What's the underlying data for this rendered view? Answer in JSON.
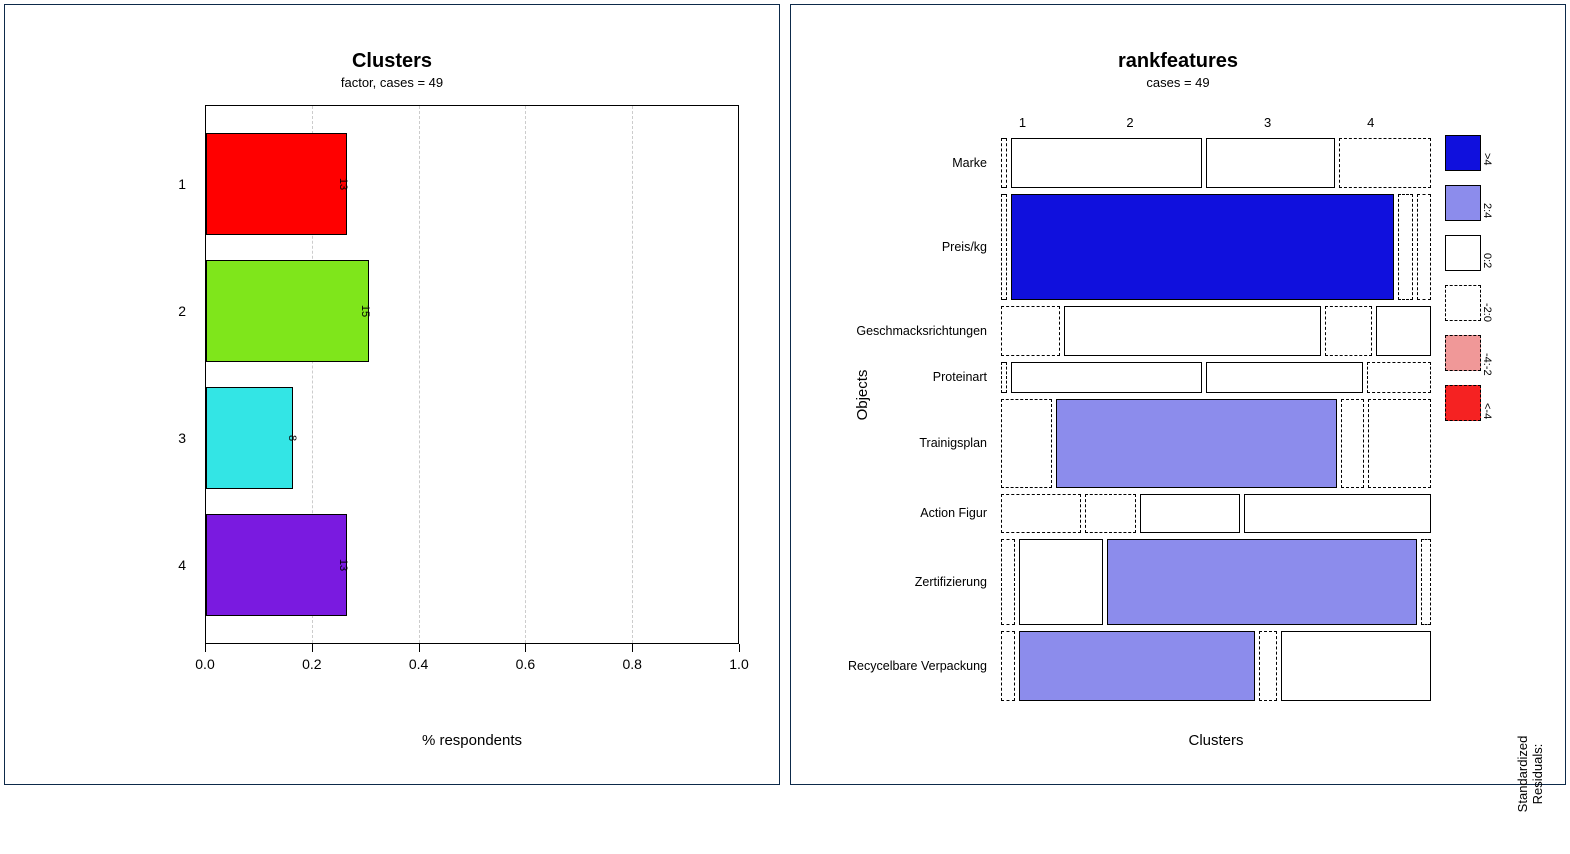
{
  "chart_data": [
    {
      "type": "bar",
      "title": "Clusters",
      "subtitle": "factor, cases = 49",
      "xlabel": "% respondents",
      "ylabel": "",
      "xlim": [
        0,
        1
      ],
      "x_ticks": [
        "0.0",
        "0.2",
        "0.4",
        "0.6",
        "0.8",
        "1.0"
      ],
      "grid_x": [
        0.2,
        0.4,
        0.6,
        0.8
      ],
      "categories": [
        "1",
        "2",
        "3",
        "4"
      ],
      "values": [
        0.265,
        0.306,
        0.163,
        0.265
      ],
      "counts": [
        13,
        15,
        8,
        13
      ],
      "colors": [
        "#ff0000",
        "#7fe61b",
        "#33e5e5",
        "#7a1ae0"
      ]
    },
    {
      "type": "mosaic",
      "title": "rankfeatures",
      "subtitle": "cases = 49",
      "xlabel": "Clusters",
      "ylabel": "Objects",
      "column_categories": [
        "1",
        "2",
        "3",
        "4"
      ],
      "row_categories": [
        "Marke",
        "Preis/kg",
        "Geschmacksrichtungen",
        "Proteinart",
        "Trainigsplan",
        "Action Figur",
        "Zertifizierung",
        "Recycelbare Verpackung"
      ],
      "row_heights": [
        0.095,
        0.205,
        0.095,
        0.06,
        0.17,
        0.075,
        0.165,
        0.135
      ],
      "cell_widths": [
        [
          0.01,
          0.46,
          0.31,
          0.22
        ],
        [
          0.01,
          0.93,
          0.03,
          0.03
        ],
        [
          0.14,
          0.62,
          0.11,
          0.13
        ],
        [
          0.01,
          0.46,
          0.38,
          0.15
        ],
        [
          0.12,
          0.68,
          0.05,
          0.15
        ],
        [
          0.19,
          0.12,
          0.24,
          0.45
        ],
        [
          0.03,
          0.2,
          0.75,
          0.02
        ],
        [
          0.03,
          0.57,
          0.04,
          0.36
        ]
      ],
      "residual_class": [
        [
          "neg",
          "zero",
          "zero",
          "neg"
        ],
        [
          "neg",
          "deep-blue",
          "neg",
          "neg"
        ],
        [
          "neg",
          "zero",
          "neg",
          "zero"
        ],
        [
          "neg",
          "zero",
          "zero",
          "neg"
        ],
        [
          "neg",
          "light-blue",
          "neg",
          "neg"
        ],
        [
          "neg",
          "neg",
          "zero",
          "zero"
        ],
        [
          "neg",
          "zero",
          "light-blue",
          "neg"
        ],
        [
          "neg",
          "light-blue",
          "neg",
          "zero"
        ]
      ],
      "legend": {
        "title": "Standardized\nResiduals:",
        "items": [
          {
            "class": "deep-blue",
            "label": ">4"
          },
          {
            "class": "light-blue",
            "label": "2:4"
          },
          {
            "class": "zero",
            "label": "0:2"
          },
          {
            "class": "neg",
            "label": "-2:0"
          },
          {
            "class": "light-red",
            "label": "-4:-2"
          },
          {
            "class": "deep-red",
            "label": "<-4"
          }
        ]
      }
    }
  ]
}
